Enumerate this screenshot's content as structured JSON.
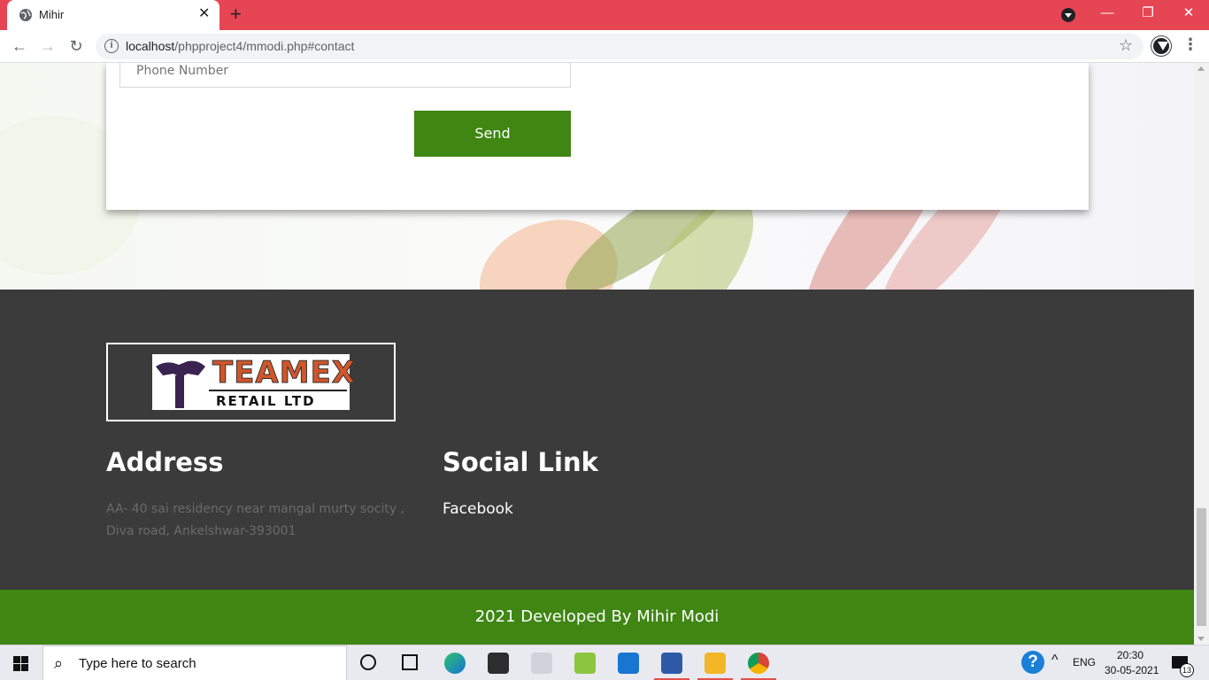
{
  "browser": {
    "tab_title": "Mihir",
    "tab_close": "✕",
    "new_tab": "+",
    "url_host": "localhost",
    "url_path": "/phpproject4/mmodi.php#contact",
    "window_minimize": "—",
    "window_restore": "❐",
    "window_close": "✕"
  },
  "contact_form": {
    "phone_placeholder": "Phone Number",
    "send_label": "Send"
  },
  "footer": {
    "logo_brand": "TEAMEX",
    "logo_sub": "RETAIL LTD",
    "address_heading": "Address",
    "address_text": "AA- 40 sai residency near mangal murty socity , Diva road, Ankelshwar-393001",
    "social_heading": "Social Link",
    "social_links": [
      "Facebook"
    ],
    "copyright": "2021 Developed By Mihir Modi"
  },
  "taskbar": {
    "search_placeholder": "Type here to search",
    "language": "ENG",
    "time": "20:30",
    "date": "30-05-2021",
    "notification_count": "13"
  },
  "colors": {
    "tab_strip": "#e64553",
    "accent_green": "#3f8613",
    "footer_bg": "#3b3b3b"
  }
}
